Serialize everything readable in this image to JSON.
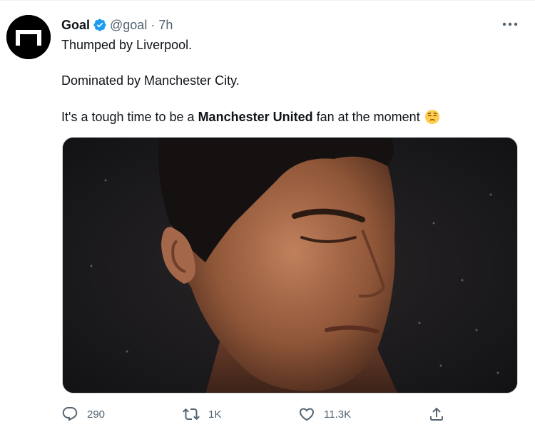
{
  "account": {
    "name": "Goal",
    "handle": "@goal",
    "separator": "·",
    "time": "7h"
  },
  "tweet": {
    "line1": "Thumped by Liverpool.",
    "line2": "Dominated by Manchester City.",
    "line3_prefix": "It's a tough time to be a ",
    "line3_bold": "Manchester United",
    "line3_suffix": " fan at the moment",
    "emoji": "pensive-face-emoji"
  },
  "media": {
    "description_icon": "photo-icon"
  },
  "actions": {
    "replies": "290",
    "retweets": "1K",
    "likes": "11.3K"
  },
  "colors": {
    "text": "#0f1419",
    "secondary": "#536471",
    "verified": "#1d9bf0",
    "border": "#cfd9de"
  }
}
